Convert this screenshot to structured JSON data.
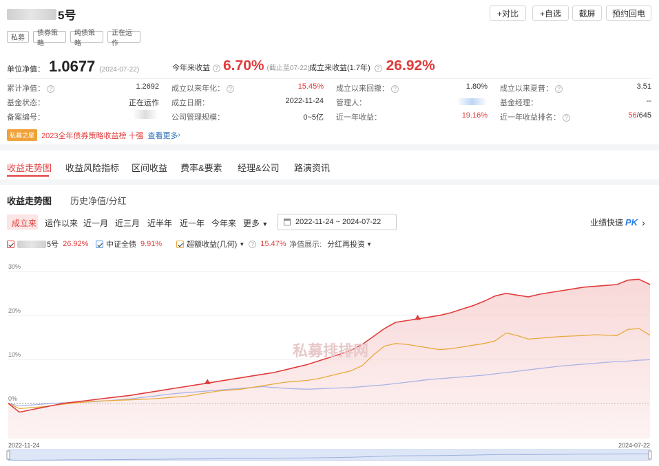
{
  "header": {
    "title_suffix": "5号",
    "actions": [
      "+对比",
      "+自选",
      "截屏",
      "预约回电"
    ],
    "tags": [
      "私募",
      "债券策略",
      "纯债策略",
      "正在运作"
    ]
  },
  "nav_box": {
    "label": "单位净值：",
    "value": "1.0677",
    "date": "(2024-07-22)"
  },
  "ytd": {
    "label": "今年来收益",
    "value": "6.70%",
    "note": "(截止至07-22)"
  },
  "since_inception": {
    "label": "成立来收益(1.7年)",
    "value": "26.92%"
  },
  "stats": [
    [
      {
        "label": "累计净值：",
        "value": "1.2692"
      },
      {
        "label": "成立以来年化：",
        "value": "15.45%"
      },
      {
        "label": "成立以来回撤：",
        "value": "1.80%"
      },
      {
        "label": "成立以来夏普：",
        "value": "3.51"
      }
    ],
    [
      {
        "label": "基金状态：",
        "value": "正在运作"
      },
      {
        "label": "成立日期：",
        "value": "2022-11-24"
      },
      {
        "label": "管理人：",
        "value": ""
      },
      {
        "label": "基金经理：",
        "value": "--"
      }
    ],
    [
      {
        "label": "备案编号：",
        "value": ""
      },
      {
        "label": "公司管理规模：",
        "value": "0~5亿"
      },
      {
        "label": "近一年收益：",
        "value": "19.16%"
      },
      {
        "label": "近一年收益排名：",
        "value": "56",
        "value2": "/645"
      }
    ]
  ],
  "award": {
    "badge": "私募之星",
    "text": "2023全年债券策略收益榜 十强",
    "link": "查看更多"
  },
  "main_tabs": [
    "收益走势图",
    "收益风险指标",
    "区间收益",
    "费率&要素",
    "经理&公司",
    "路演资讯"
  ],
  "sub_tabs": [
    "收益走势图",
    "历史净值/分红"
  ],
  "ranges": [
    "成立来",
    "运作以来",
    "近一月",
    "近三月",
    "近半年",
    "近一年",
    "今年来",
    "更多"
  ],
  "date_range": "2022-11-24 ~ 2024-07-22",
  "pk": {
    "label": "业绩快速",
    "badge": "PK"
  },
  "legend": [
    {
      "name": "5号",
      "value": "26.92%",
      "color": "#e03b3b"
    },
    {
      "name": "中证全债",
      "value": "9.91%",
      "color": "#4a90e2"
    },
    {
      "name": "超额收益(几何)",
      "value": "15.47%",
      "color": "#e8a93a"
    }
  ],
  "display_label": "净值展示:",
  "display_mode": "分红再投资",
  "watermark": "私募排排网",
  "chart_data": {
    "type": "line",
    "ylim": [
      -8,
      32
    ],
    "yticks": [
      "30%",
      "20%",
      "10%",
      "0%"
    ],
    "x_labels": [
      "2022-11-24",
      "2024-07-22"
    ],
    "series": [
      {
        "name": "5号",
        "color": "#e03b3b",
        "values": [
          0,
          -2,
          -1.5,
          -1,
          -0.5,
          0,
          0.3,
          0.6,
          0.9,
          1.2,
          1.5,
          1.8,
          2.2,
          2.6,
          3.0,
          3.4,
          3.8,
          4.2,
          4.6,
          5.0,
          5.4,
          5.8,
          6.2,
          6.6,
          7.0,
          7.6,
          8.2,
          8.8,
          9.6,
          10.4,
          11.2,
          12.1,
          13.4,
          15.2,
          17.0,
          18.4,
          18.8,
          19.2,
          19.6,
          20.0,
          20.6,
          21.4,
          22.2,
          23.2,
          24.4,
          25.0,
          24.6,
          24.2,
          24.8,
          25.2,
          25.6,
          26.0,
          26.4,
          26.6,
          26.8,
          27.0,
          28.0,
          28.2,
          27.0
        ]
      },
      {
        "name": "中证全债",
        "color": "#a9b4e6",
        "values": [
          0,
          -0.6,
          -0.4,
          -0.2,
          0,
          0.1,
          0.2,
          0.3,
          0.4,
          0.6,
          0.8,
          1.0,
          1.3,
          1.6,
          1.9,
          2.2,
          2.4,
          2.6,
          2.8,
          3.0,
          3.2,
          3.4,
          3.6,
          3.8,
          3.6,
          3.4,
          3.3,
          3.2,
          3.3,
          3.4,
          3.5,
          3.6,
          3.8,
          4.0,
          4.2,
          4.5,
          4.8,
          5.1,
          5.4,
          5.6,
          5.8,
          6.0,
          6.2,
          6.4,
          6.7,
          7.0,
          7.3,
          7.6,
          7.9,
          8.2,
          8.5,
          8.7,
          8.9,
          9.1,
          9.3,
          9.5,
          9.6,
          9.8,
          9.91
        ]
      },
      {
        "name": "超额收益(几何)",
        "color": "#e8a93a",
        "values": [
          0,
          -1.2,
          -1.0,
          -0.8,
          -0.5,
          -0.2,
          0.1,
          0.3,
          0.5,
          0.6,
          0.7,
          0.8,
          0.9,
          1.0,
          1.2,
          1.4,
          1.6,
          2.0,
          2.4,
          2.8,
          3.0,
          3.2,
          3.6,
          4.0,
          4.4,
          4.8,
          5.0,
          5.2,
          5.6,
          6.2,
          6.8,
          7.4,
          8.6,
          11.0,
          13.0,
          13.6,
          13.4,
          13.0,
          12.6,
          12.2,
          12.4,
          12.8,
          13.2,
          13.6,
          14.2,
          16.0,
          15.4,
          14.6,
          14.8,
          15.0,
          15.2,
          15.3,
          15.4,
          15.6,
          15.5,
          15.4,
          16.8,
          17.0,
          15.47
        ]
      }
    ],
    "markers": [
      {
        "series": "5号",
        "index": 18
      },
      {
        "series": "5号",
        "index": 37
      }
    ]
  }
}
